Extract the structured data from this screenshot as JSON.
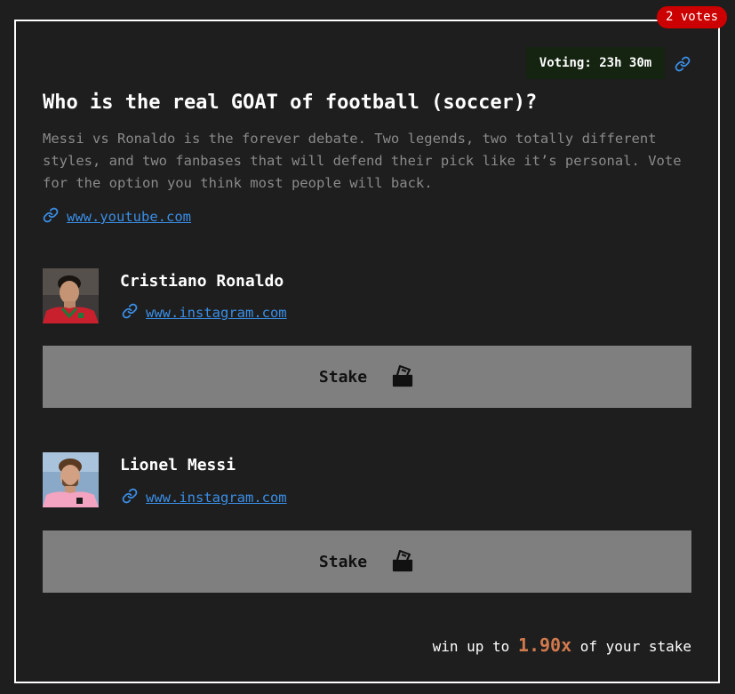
{
  "badge": {
    "votes_label": "2 votes"
  },
  "poll": {
    "timer_label": "Voting: 23h 30m",
    "title": "Who is the real GOAT of football (soccer)?",
    "description": "Messi vs Ronaldo is the forever debate. Two legends, two totally different styles, and two fanbases that will defend their pick like it’s personal. Vote for the option you think most people will back.",
    "link_text": "www.youtube.com"
  },
  "options": [
    {
      "name": "Cristiano Ronaldo",
      "link_text": "www.instagram.com",
      "stake_label": "Stake"
    },
    {
      "name": "Lionel Messi",
      "link_text": "www.instagram.com",
      "stake_label": "Stake"
    }
  ],
  "footer": {
    "prefix": "win up to",
    "multiplier": "1.90x",
    "suffix": "of your stake"
  },
  "icons": {
    "share": "link-icon",
    "option_link": "link-icon",
    "stake": "ballot-box-icon"
  },
  "colors": {
    "accent_link": "#3a8ee6",
    "badge": "#cc0000",
    "multiplier": "#d07a4e",
    "stake_button": "#7f7f7f",
    "timer_bg": "#142410"
  }
}
